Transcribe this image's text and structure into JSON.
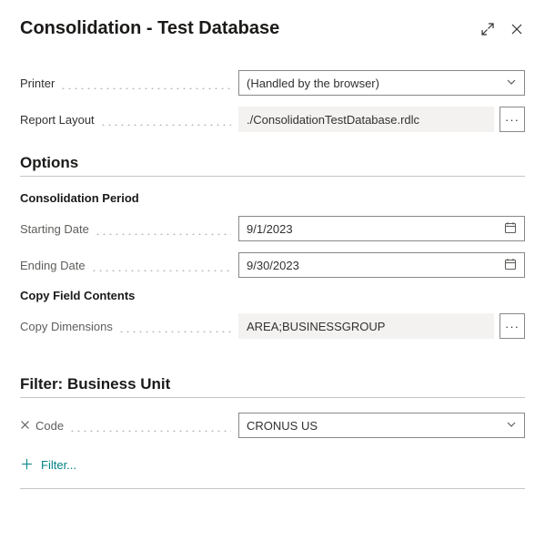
{
  "header": {
    "title": "Consolidation - Test Database"
  },
  "general": {
    "printer": {
      "label": "Printer",
      "value": "(Handled by the browser)"
    },
    "report_layout": {
      "label": "Report Layout",
      "value": "./ConsolidationTestDatabase.rdlc"
    }
  },
  "options": {
    "section_title": "Options",
    "period_heading": "Consolidation Period",
    "starting_date": {
      "label": "Starting Date",
      "value": "9/1/2023"
    },
    "ending_date": {
      "label": "Ending Date",
      "value": "9/30/2023"
    },
    "copy_heading": "Copy Field Contents",
    "copy_dimensions": {
      "label": "Copy Dimensions",
      "value": "AREA;BUSINESSGROUP"
    }
  },
  "filter": {
    "section_title": "Filter: Business Unit",
    "code": {
      "label": "Code",
      "value": "CRONUS US"
    },
    "add_label": "Filter..."
  },
  "glyphs": {
    "more": "···"
  }
}
